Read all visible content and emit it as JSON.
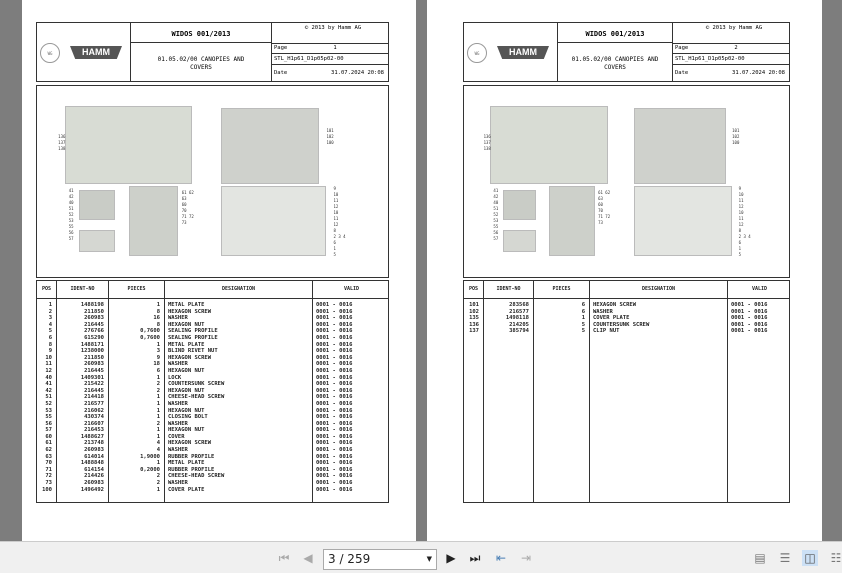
{
  "pages": [
    {
      "title": "WIDOS 001/2013",
      "copyright": "© 2013 by Hamm AG",
      "section_line1": "01.05.02/00 CANOPIES AND",
      "section_line2": "COVERS",
      "page_label": "Page",
      "page_value": "1",
      "stl": "STL_H1p61_D1p05p02-00",
      "date_label": "Date",
      "date_value": "31.07.2024  20:08",
      "logo_left": "WIRTGEN GROUP",
      "logo_right": "HAMM",
      "columns": [
        "POS",
        "IDENT-NO",
        "PIECES",
        "DESIGNATION",
        "VALID"
      ],
      "rows": [
        [
          "1",
          "1488198",
          "1",
          "METAL PLATE",
          "0001 - 0016"
        ],
        [
          "2",
          "211850",
          "8",
          "HEXAGON SCREW",
          "0001 - 0016"
        ],
        [
          "3",
          "260983",
          "16",
          "WASHER",
          "0001 - 0016"
        ],
        [
          "4",
          "216445",
          "8",
          "HEXAGON NUT",
          "0001 - 0016"
        ],
        [
          "5",
          "276766",
          "0,7600",
          "SEALING PROFILE",
          "0001 - 0016"
        ],
        [
          "6",
          "615290",
          "0,7600",
          "SEALING PROFILE",
          "0001 - 0016"
        ],
        [
          "8",
          "1488171",
          "1",
          "METAL PLATE",
          "0001 - 0016"
        ],
        [
          "9",
          "1238000",
          "3",
          "BLIND RIVET NUT",
          "0001 - 0016"
        ],
        [
          "10",
          "211850",
          "9",
          "HEXAGON SCREW",
          "0001 - 0016"
        ],
        [
          "11",
          "260983",
          "18",
          "WASHER",
          "0001 - 0016"
        ],
        [
          "12",
          "216445",
          "6",
          "HEXAGON NUT",
          "0001 - 0016"
        ],
        [
          "40",
          "1409301",
          "1",
          "LOCK",
          "0001 - 0016"
        ],
        [
          "41",
          "215422",
          "2",
          "COUNTERSUNK SCREW",
          "0001 - 0016"
        ],
        [
          "42",
          "216445",
          "2",
          "HEXAGON NUT",
          "0001 - 0016"
        ],
        [
          "51",
          "214418",
          "1",
          "CHEESE-HEAD SCREW",
          "0001 - 0016"
        ],
        [
          "52",
          "216577",
          "1",
          "WASHER",
          "0001 - 0016"
        ],
        [
          "53",
          "216062",
          "1",
          "HEXAGON NUT",
          "0001 - 0016"
        ],
        [
          "55",
          "430374",
          "1",
          "CLOSING BOLT",
          "0001 - 0016"
        ],
        [
          "56",
          "216607",
          "2",
          "WASHER",
          "0001 - 0016"
        ],
        [
          "57",
          "216453",
          "1",
          "HEXAGON NUT",
          "0001 - 0016"
        ],
        [
          "60",
          "1488627",
          "1",
          "COVER",
          "0001 - 0016"
        ],
        [
          "61",
          "213748",
          "4",
          "HEXAGON SCREW",
          "0001 - 0016"
        ],
        [
          "62",
          "260983",
          "4",
          "WASHER",
          "0001 - 0016"
        ],
        [
          "63",
          "614014",
          "1,9000",
          "RUBBER PROFILE",
          "0001 - 0016"
        ],
        [
          "70",
          "1488848",
          "1",
          "METAL PLATE",
          "0001 - 0016"
        ],
        [
          "71",
          "614154",
          "0,2000",
          "RUBBER PROFILE",
          "0001 - 0016"
        ],
        [
          "72",
          "214426",
          "2",
          "CHEESE-HEAD SCREW",
          "0001 - 0016"
        ],
        [
          "73",
          "260983",
          "2",
          "WASHER",
          "0001 - 0016"
        ],
        [
          "100",
          "1496492",
          "1",
          "COVER PLATE",
          "0001 - 0016"
        ]
      ]
    },
    {
      "title": "WIDOS 001/2013",
      "copyright": "© 2013 by Hamm AG",
      "section_line1": "01.05.02/00 CANOPIES AND",
      "section_line2": "COVERS",
      "page_label": "Page",
      "page_value": "2",
      "stl": "STL_H1p61_D1p05p02-00",
      "date_label": "Date",
      "date_value": "31.07.2024  20:08",
      "logo_left": "WIRTGEN GROUP",
      "logo_right": "HAMM",
      "columns": [
        "POS",
        "IDENT-NO",
        "PIECES",
        "DESIGNATION",
        "VALID"
      ],
      "rows": [
        [
          "101",
          "283568",
          "6",
          "HEXAGON SCREW",
          "0001 - 0016"
        ],
        [
          "102",
          "216577",
          "6",
          "WASHER",
          "0001 - 0016"
        ],
        [
          "135",
          "1498118",
          "1",
          "COVER PLATE",
          "0001 - 0016"
        ],
        [
          "136",
          "214205",
          "5",
          "COUNTERSUNK SCREW",
          "0001 - 0016"
        ],
        [
          "137",
          "385794",
          "5",
          "CLIP NUT",
          "0001 - 0016"
        ]
      ]
    }
  ],
  "callouts": {
    "tl": [
      "136",
      "137",
      "138"
    ],
    "tr": [
      "101",
      "102",
      "100"
    ],
    "ml": [
      "41",
      "42",
      "40",
      "51",
      "52",
      "53",
      "55",
      "56",
      "57"
    ],
    "mm": [
      "61 62",
      "63",
      "60",
      "70",
      "71 72",
      "73"
    ],
    "mr": [
      "9",
      "10",
      "11",
      "12",
      "10",
      "11",
      "12",
      "8",
      "2 3 4",
      "6",
      "1",
      "5"
    ]
  },
  "toolbar": {
    "page_input": "3 / 259"
  }
}
